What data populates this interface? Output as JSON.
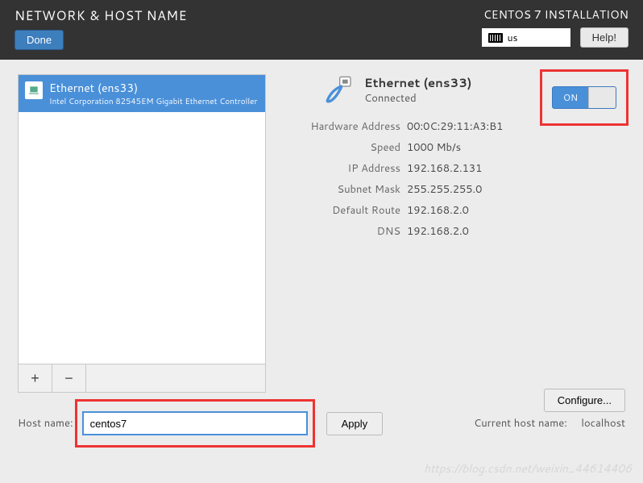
{
  "header": {
    "title": "NETWORK & HOST NAME",
    "done_label": "Done",
    "install_title": "CENTOS 7 INSTALLATION",
    "keyboard_layout": "us",
    "help_label": "Help!"
  },
  "device_list": {
    "selected": {
      "name": "Ethernet (ens33)",
      "sub": "Intel Corporation 82545EM Gigabit Ethernet Controller ("
    },
    "add_label": "+",
    "remove_label": "−"
  },
  "network": {
    "title": "Ethernet (ens33)",
    "status": "Connected",
    "toggle_on": "ON",
    "details": [
      {
        "label": "Hardware Address",
        "value": "00:0C:29:11:A3:B1"
      },
      {
        "label": "Speed",
        "value": "1000 Mb/s"
      },
      {
        "label": "IP Address",
        "value": "192.168.2.131"
      },
      {
        "label": "Subnet Mask",
        "value": "255.255.255.0"
      },
      {
        "label": "Default Route",
        "value": "192.168.2.0"
      },
      {
        "label": "DNS",
        "value": "192.168.2.0"
      }
    ],
    "configure_label": "Configure..."
  },
  "hostname": {
    "label": "Host name:",
    "value": "centos7",
    "apply_label": "Apply",
    "current_label": "Current host name:",
    "current_value": "localhost"
  },
  "watermark": "https://blog.csdn.net/weixin_44614406"
}
